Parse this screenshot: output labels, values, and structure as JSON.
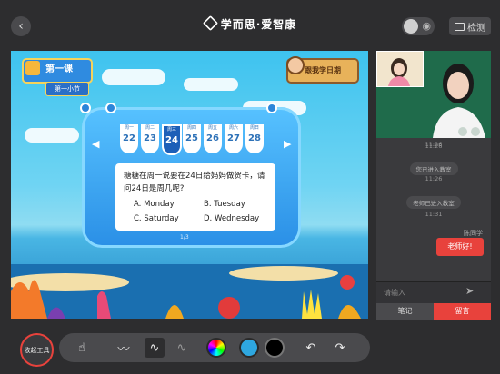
{
  "header": {
    "back_icon": "chevron-left-icon",
    "brand": "学而思·爱智康",
    "eye_toggle_icon": "eye-icon",
    "detect_label": "检测"
  },
  "lesson": {
    "title": "第一课",
    "section": "第一小节",
    "sign": "跟我学日期"
  },
  "calendar": {
    "days": [
      {
        "weekday": "周一",
        "date": "22"
      },
      {
        "weekday": "周二",
        "date": "23"
      },
      {
        "weekday": "周三",
        "date": "24",
        "selected": true
      },
      {
        "weekday": "周四",
        "date": "25"
      },
      {
        "weekday": "周五",
        "date": "26"
      },
      {
        "weekday": "周六",
        "date": "27"
      },
      {
        "weekday": "周日",
        "date": "28"
      }
    ]
  },
  "question": {
    "text": "糖糖在周一说要在24日给妈妈做贺卡，请问24日是周几呢?",
    "options": {
      "a": "A. Monday",
      "b": "B. Tuesday",
      "c": "C. Saturday",
      "d": "D. Wednesday"
    },
    "page": "1/3"
  },
  "chat": {
    "messages": [
      {
        "type": "time",
        "text": "11:26"
      },
      {
        "type": "time",
        "text": "11:26"
      },
      {
        "type": "system",
        "text": "您已进入教室"
      },
      {
        "type": "time",
        "text": "11:26"
      },
      {
        "type": "system",
        "text": "老师已进入教室"
      },
      {
        "type": "time",
        "text": "11:31"
      }
    ],
    "sender": "陈同学",
    "bubble": "老师好!",
    "input_placeholder": "请输入",
    "tab_notes": "笔记",
    "tab_message": "留言"
  },
  "toolbar": {
    "collapse_label": "收起工具",
    "tools": [
      "hand-pointer-icon",
      "pen-icon",
      "pen-thin-icon",
      "pen-fade-icon",
      "color-wheel-icon",
      "undo-icon",
      "redo-icon"
    ],
    "selected_color": "#2ea7e0",
    "colors": [
      "#2ea7e0",
      "#000000"
    ]
  },
  "accent": "#e8423c"
}
